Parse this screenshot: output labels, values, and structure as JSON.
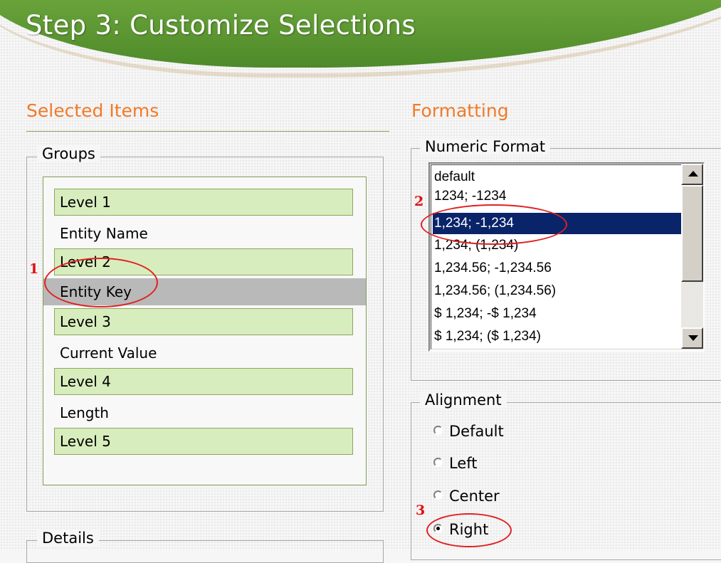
{
  "page": {
    "title": "Step 3: Customize Selections"
  },
  "selected_items": {
    "heading": "Selected Items",
    "groups_legend": "Groups",
    "rows": [
      {
        "kind": "level",
        "label": "Level 1"
      },
      {
        "kind": "entity",
        "label": "Entity Name"
      },
      {
        "kind": "level",
        "label": "Level 2"
      },
      {
        "kind": "entity",
        "label": "Entity Key",
        "selected": true
      },
      {
        "kind": "level",
        "label": "Level 3"
      },
      {
        "kind": "entity",
        "label": "Current Value"
      },
      {
        "kind": "level",
        "label": "Level 4"
      },
      {
        "kind": "entity",
        "label": "Length"
      },
      {
        "kind": "level",
        "label": "Level 5"
      }
    ],
    "details_legend": "Details"
  },
  "formatting": {
    "heading": "Formatting",
    "numeric_format": {
      "legend": "Numeric Format",
      "options": [
        "default",
        "1234; -1234",
        "1,234; -1,234",
        "1,234; (1,234)",
        "1,234.56; -1,234.56",
        "1,234.56; (1,234.56)",
        "$ 1,234; -$ 1,234",
        "$ 1,234; ($ 1,234)"
      ],
      "selected": "1,234; -1,234"
    },
    "alignment": {
      "legend": "Alignment",
      "options": [
        "Default",
        "Left",
        "Center",
        "Right"
      ],
      "selected": "Right"
    }
  },
  "annotations": {
    "marker_1": "1",
    "marker_2": "2",
    "marker_3": "3"
  },
  "colors": {
    "banner_green": "#6aa33a",
    "heading_orange": "#f07a2a",
    "level_fill": "#d8edbd",
    "list_selection": "#0a246a",
    "annotation_red": "#e01010"
  },
  "icons": [
    "scroll-up-arrow-icon",
    "scroll-down-arrow-icon",
    "radio-button-icon"
  ]
}
